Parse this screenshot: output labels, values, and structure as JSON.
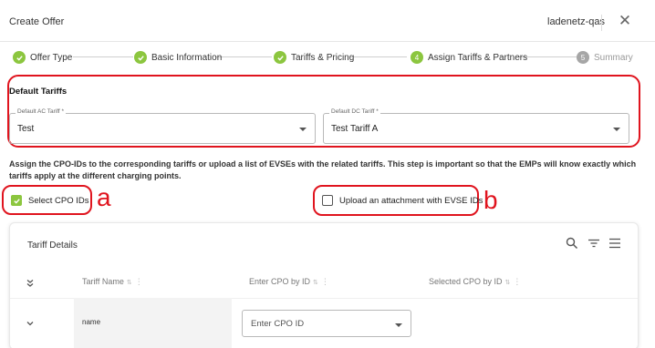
{
  "header": {
    "title": "Create Offer",
    "environment": "ladenetz-qas",
    "close_icon": "close-icon"
  },
  "stepper": {
    "steps": [
      {
        "label": "Offer Type",
        "state": "completed"
      },
      {
        "label": "Basic Information",
        "state": "completed"
      },
      {
        "label": "Tariffs & Pricing",
        "state": "completed"
      },
      {
        "number": "4",
        "label": "Assign Tariffs & Partners",
        "state": "active"
      },
      {
        "number": "5",
        "label": "Summary",
        "state": "pending"
      }
    ]
  },
  "default_tariffs": {
    "heading": "Default Tariffs",
    "ac": {
      "label": "Default AC Tariff *",
      "value": "Test"
    },
    "dc": {
      "label": "Default DC Tariff *",
      "value": "Test Tariff A"
    }
  },
  "info_text": "Assign the CPO-IDs to the corresponding tariffs or upload a list of EVSEs with the related tariffs. This step is important so that the EMPs will know exactly which tariffs apply at the different charging points.",
  "options": {
    "select_cpo": {
      "label": "Select CPO IDs",
      "checked": true,
      "marker": "a"
    },
    "upload": {
      "label": "Upload an attachment with EVSE IDs",
      "checked": false,
      "marker": "b"
    }
  },
  "table": {
    "title": "Tariff Details",
    "columns": [
      "Tariff Name",
      "Enter CPO by ID",
      "Selected CPO by ID"
    ],
    "rows": [
      {
        "name": "name",
        "cpo_input_placeholder": "Enter CPO ID",
        "selected": ""
      }
    ]
  },
  "colors": {
    "accent_green": "#8cc63f",
    "highlight_red": "#e0141e"
  }
}
